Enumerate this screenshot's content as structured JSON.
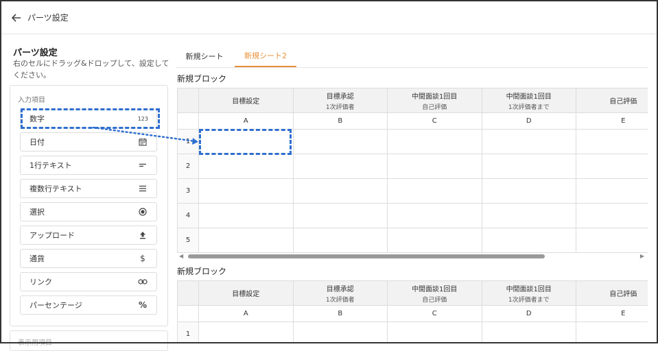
{
  "header": {
    "title": "パーツ設定",
    "back_icon": "arrow-left-icon"
  },
  "panel": {
    "title": "パーツ設定",
    "description": "右のセルにドラッグ&ドロップして、設定してください。",
    "input_section_label": "入力項目",
    "items": [
      {
        "label": "数字",
        "icon": "number-123-icon",
        "icon_text": "123"
      },
      {
        "label": "日付",
        "icon": "calendar-icon"
      },
      {
        "label": "1行テキスト",
        "icon": "single-line-icon"
      },
      {
        "label": "複数行テキスト",
        "icon": "multi-line-icon"
      },
      {
        "label": "選択",
        "icon": "radio-icon"
      },
      {
        "label": "アップロード",
        "icon": "upload-icon"
      },
      {
        "label": "通貨",
        "icon": "dollar-icon",
        "icon_text": "$"
      },
      {
        "label": "リンク",
        "icon": "link-icon"
      },
      {
        "label": "パーセンテージ",
        "icon": "percent-icon",
        "icon_text": "%"
      }
    ],
    "second_section_label": "表示用項目"
  },
  "tabs": [
    {
      "label": "新規シート",
      "active": false
    },
    {
      "label": "新規シート2",
      "active": true
    }
  ],
  "blocks": [
    {
      "title": "新規ブロック",
      "columns": [
        {
          "title": "目標設定",
          "sub": "",
          "letter": "A"
        },
        {
          "title": "目標承認",
          "sub": "1次評価者",
          "letter": "B"
        },
        {
          "title": "中間面談1回目",
          "sub": "自己評価",
          "letter": "C"
        },
        {
          "title": "中間面談1回目",
          "sub": "1次評価者まで",
          "letter": "D"
        },
        {
          "title": "自己評価",
          "sub": "",
          "letter": "E"
        }
      ],
      "rows": [
        "1",
        "2",
        "3",
        "4",
        "5"
      ]
    },
    {
      "title": "新規ブロック",
      "columns": [
        {
          "title": "目標設定",
          "sub": "",
          "letter": "A"
        },
        {
          "title": "目標承認",
          "sub": "1次評価者",
          "letter": "B"
        },
        {
          "title": "中間面談1回目",
          "sub": "自己評価",
          "letter": "C"
        },
        {
          "title": "中間面談1回目",
          "sub": "1次評価者まで",
          "letter": "D"
        },
        {
          "title": "自己評価",
          "sub": "",
          "letter": "E"
        }
      ],
      "rows": [
        "1"
      ]
    }
  ],
  "colors": {
    "accent": "#e8913b",
    "highlight": "#2f6fd0",
    "header_bg": "#f2f2f2",
    "border": "#dcdcdc"
  }
}
